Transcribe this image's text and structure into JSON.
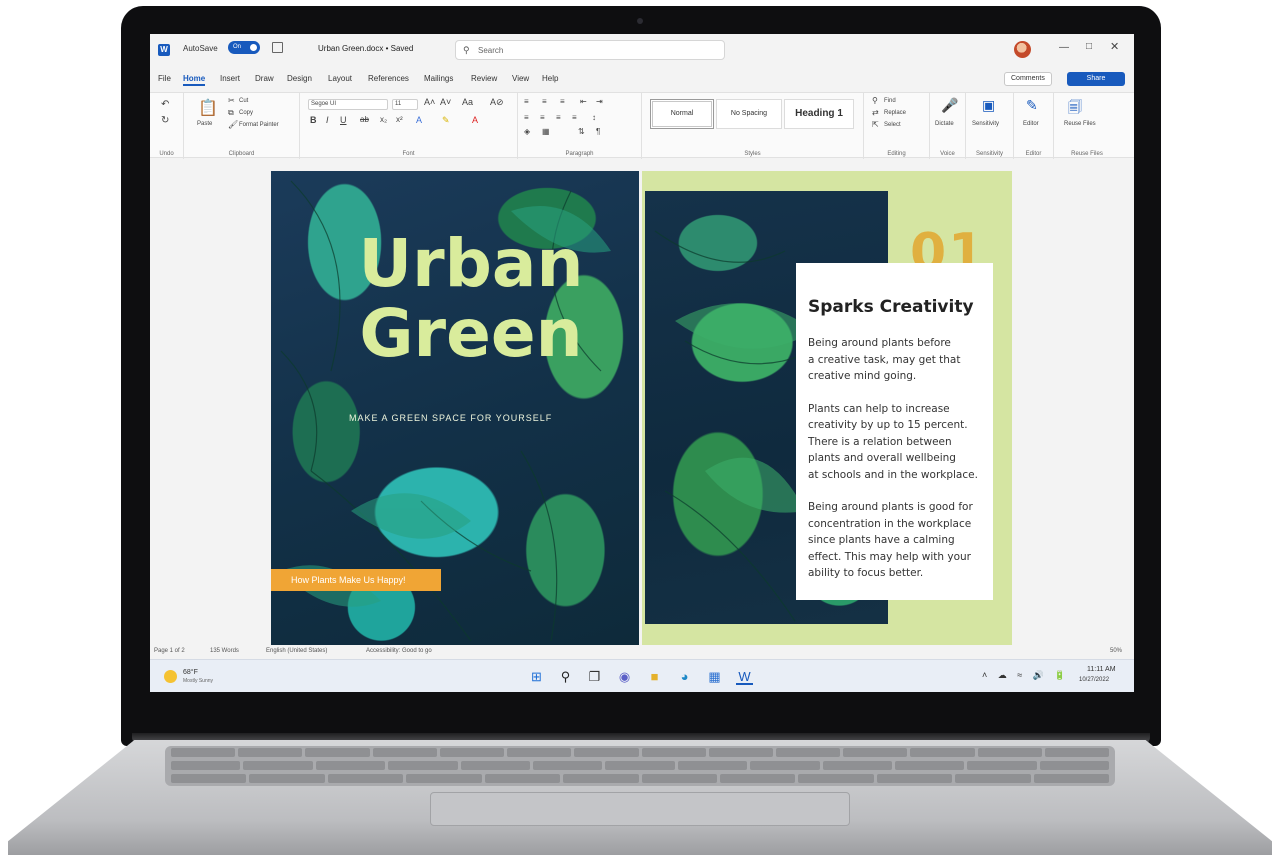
{
  "titlebar": {
    "app_icon": "word-icon",
    "app_icon_letter": "W",
    "autosave_label": "AutoSave",
    "autosave_state": "On",
    "document_title": "Urban Green.docx • Saved",
    "search_placeholder": "Search"
  },
  "tabs": [
    {
      "label": "File"
    },
    {
      "label": "Home"
    },
    {
      "label": "Insert"
    },
    {
      "label": "Draw"
    },
    {
      "label": "Design"
    },
    {
      "label": "Layout"
    },
    {
      "label": "References"
    },
    {
      "label": "Mailings"
    },
    {
      "label": "Review"
    },
    {
      "label": "View"
    },
    {
      "label": "Help"
    }
  ],
  "active_tab": "Home",
  "actions": {
    "comments": "Comments",
    "share": "Share"
  },
  "ribbon": {
    "undo": {
      "group_label": "Undo"
    },
    "clipboard": {
      "paste": "Paste",
      "cut": "Cut",
      "copy": "Copy",
      "format_painter": "Format Painter",
      "group_label": "Clipboard"
    },
    "font": {
      "font_name": "Segoe UI",
      "font_size": "11",
      "group_label": "Font"
    },
    "paragraph": {
      "group_label": "Paragraph"
    },
    "styles": {
      "items": [
        "Normal",
        "No Spacing",
        "Heading 1"
      ],
      "group_label": "Styles"
    },
    "editing": {
      "find": "Find",
      "replace": "Replace",
      "select": "Select",
      "group_label": "Editing"
    },
    "voice": {
      "dictate": "Dictate",
      "group_label": "Voice"
    },
    "sensitivity": {
      "label": "Sensitivity",
      "group_label": "Sensitivity"
    },
    "editor": {
      "label": "Editor",
      "group_label": "Editor"
    },
    "reuse": {
      "label": "Reuse Files",
      "group_label": "Reuse Files"
    }
  },
  "document": {
    "left_page": {
      "title_line1": "Urban",
      "title_line2": "Green",
      "tagline": "MAKE A GREEN SPACE FOR YOURSELF",
      "cta": "How Plants Make Us Happy!"
    },
    "right_page": {
      "number": "01",
      "heading": "Sparks Creativity",
      "paragraphs": [
        "Being around plants before\na creative task, may get that\ncreative mind going.",
        "Plants can help to increase\ncreativity by up to 15 percent.\nThere is a relation between\nplants and overall wellbeing\nat schools and in the workplace.",
        "Being around plants is good for\nconcentration in the workplace\nsince plants have a calming\neffect. This may help with your\nability to focus better."
      ]
    }
  },
  "status_bar": {
    "page": "Page 1 of 2",
    "words": "135 Words",
    "language": "English (United States)",
    "accessibility": "Accessibility: Good to go",
    "zoom": "50%"
  },
  "taskbar": {
    "weather_temp": "68°F",
    "weather_desc": "Mostly Sunny",
    "apps": [
      "windows-start",
      "search",
      "task-view",
      "chat",
      "file-explorer",
      "edge",
      "store",
      "word"
    ],
    "time": "11:11 AM",
    "date": "10/27/2022"
  },
  "colors": {
    "word_blue": "#185abd",
    "title_green": "#d9ec9c",
    "cta_orange": "#f0a535",
    "accent_gold": "#e0b040",
    "page_lime": "#d5e5a2"
  }
}
